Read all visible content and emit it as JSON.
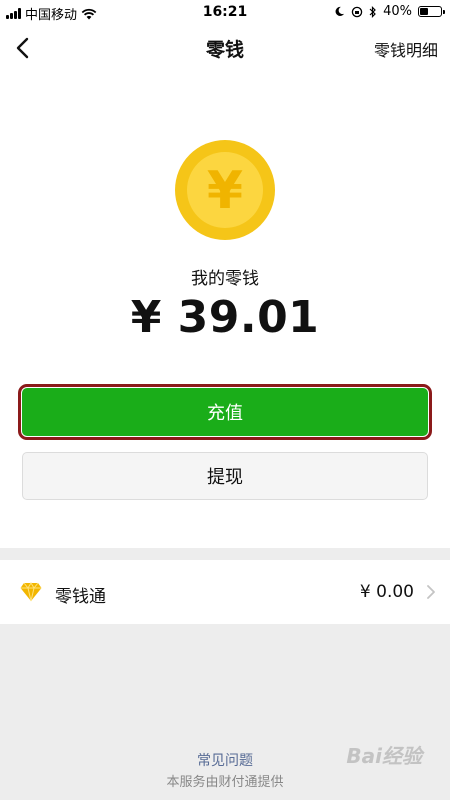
{
  "status_bar": {
    "carrier": "中国移动",
    "time": "16:21",
    "battery_text": "40%",
    "battery_level": 0.4
  },
  "nav": {
    "title": "零钱",
    "detail_link": "零钱明细",
    "back_icon": "chevron-left-icon"
  },
  "wallet": {
    "coin_symbol": "¥",
    "label": "我的零钱",
    "amount": "¥ 39.01"
  },
  "actions": {
    "recharge_label": "充值",
    "withdraw_label": "提现"
  },
  "lingqiantong": {
    "label": "零钱通",
    "value": "¥ 0.00",
    "icon": "diamond-icon"
  },
  "footer": {
    "faq_link": "常见问题",
    "provider_note": "本服务由财付通提供"
  },
  "watermark": "Bai经验",
  "colors": {
    "primary_green": "#1aad19",
    "coin_yellow": "#f5c518",
    "highlight_border": "#8b1a1a",
    "link_blue": "#576b95"
  }
}
